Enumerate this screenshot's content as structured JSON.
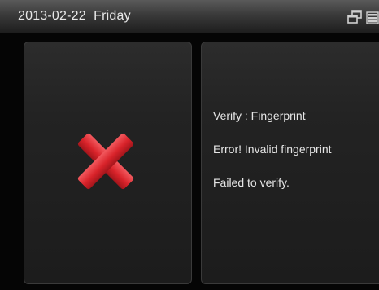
{
  "status_bar": {
    "date_text": "2013-02-22  Friday",
    "icons": [
      "network-icon",
      "battery-icon"
    ]
  },
  "result_panel": {
    "icon": "error-x-icon",
    "icon_color": "#d9232a"
  },
  "message_panel": {
    "line_1": "Verify : Fingerprint",
    "line_2": "Error! Invalid fingerprint",
    "line_3": "Failed to verify."
  }
}
